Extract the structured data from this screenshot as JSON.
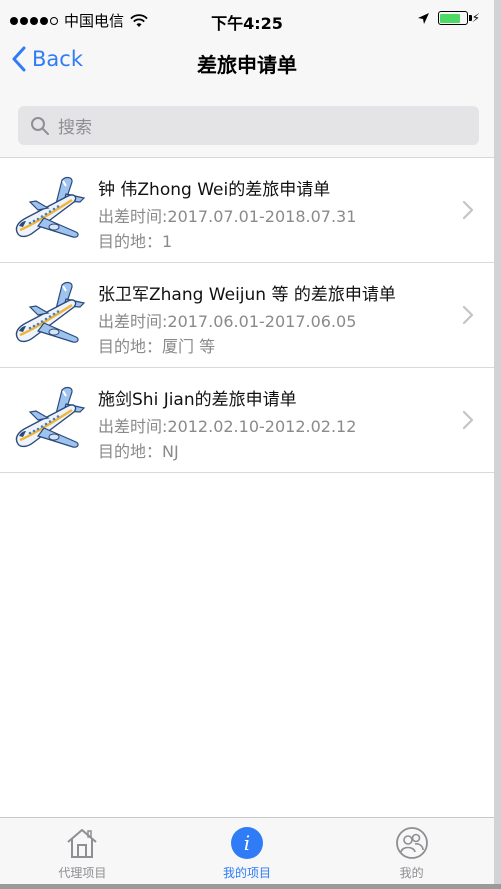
{
  "status_bar": {
    "carrier": "中国电信",
    "time": "下午4:25",
    "signal_bars": 4,
    "battery_level": 0.8
  },
  "nav": {
    "back_label": "Back",
    "title": "差旅申请单"
  },
  "search": {
    "placeholder": "搜索"
  },
  "applications": [
    {
      "title": "钟 伟Zhong Wei的差旅申请单",
      "time": "出差时间:2017.07.01-2018.07.31",
      "destination": "目的地：1"
    },
    {
      "title": "张卫军Zhang Weijun 等 的差旅申请单",
      "time": "出差时间:2017.06.01-2017.06.05",
      "destination": "目的地：厦门 等"
    },
    {
      "title": "施剑Shi Jian的差旅申请单",
      "time": "出差时间:2012.02.10-2012.02.12",
      "destination": "目的地：NJ"
    }
  ],
  "tabs": [
    {
      "label": "代理项目",
      "icon": "home-icon",
      "active": false
    },
    {
      "label": "我的项目",
      "icon": "info-icon",
      "active": true
    },
    {
      "label": "我的",
      "icon": "people-icon",
      "active": false
    }
  ],
  "colors": {
    "accent": "#2f7cf6",
    "battery": "#4cd964"
  }
}
